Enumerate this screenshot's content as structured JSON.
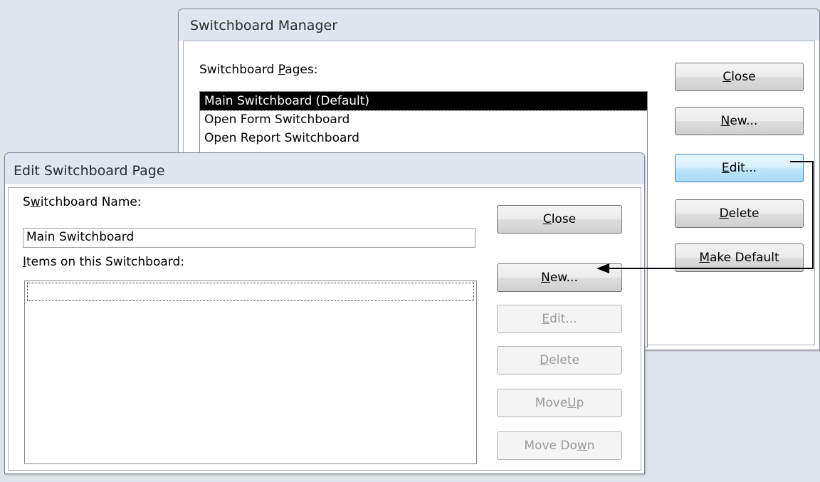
{
  "switchboard_manager": {
    "title": "Switchboard Manager",
    "pages_label_pre": "Switchboard ",
    "pages_label_u": "P",
    "pages_label_post": "ages:",
    "pages": [
      "Main Switchboard (Default)",
      "Open Form Switchboard",
      "Open Report Switchboard"
    ],
    "selected_index": 0,
    "buttons": {
      "close": {
        "u": "C",
        "rest": "lose"
      },
      "new": {
        "u": "N",
        "rest": "ew..."
      },
      "edit": {
        "u": "E",
        "rest": "dit..."
      },
      "delete": {
        "u": "D",
        "rest": "elete"
      },
      "make_default": {
        "u": "M",
        "rest": "ake Default"
      }
    }
  },
  "edit_switchboard_page": {
    "title": "Edit Switchboard Page",
    "name_label_pre": "S",
    "name_label_u": "w",
    "name_label_post": "itchboard Name:",
    "name_value": "Main Switchboard",
    "items_label_u": "I",
    "items_label_post": "tems on this Switchboard:",
    "items": [],
    "buttons": {
      "close": {
        "u": "C",
        "rest": "lose"
      },
      "new": {
        "u": "N",
        "rest": "ew..."
      },
      "edit": {
        "u": "E",
        "rest": "dit..."
      },
      "delete": {
        "u": "D",
        "rest": "elete"
      },
      "move_up": {
        "pre": "Move ",
        "u": "U",
        "rest": "p"
      },
      "move_down": {
        "pre": "Move Do",
        "u": "w",
        "rest": "n"
      }
    }
  },
  "annotation": {
    "arrow_color": "#000000"
  }
}
